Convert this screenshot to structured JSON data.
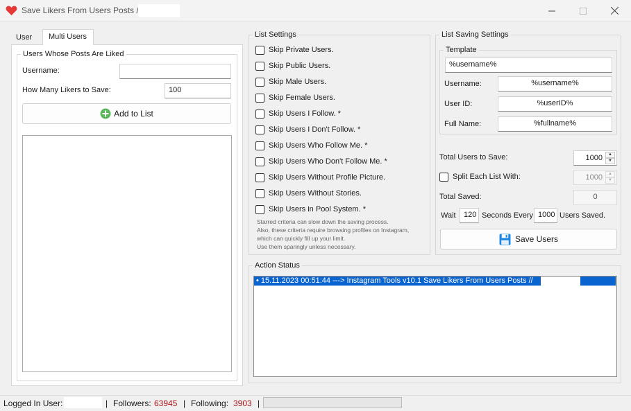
{
  "window": {
    "title": "Save Likers From Users Posts // ",
    "buttons": {
      "minimize": "—",
      "maximize": "☐",
      "close": "✕"
    }
  },
  "tabs": [
    {
      "label": "User",
      "active": false
    },
    {
      "label": "Multi Users",
      "active": true
    }
  ],
  "left_group": {
    "legend": "Users Whose Posts Are Liked",
    "username_label": "Username:",
    "username_value": "",
    "likers_label": "How Many Likers to Save:",
    "likers_value": "100",
    "add_button": "Add to List"
  },
  "list_settings": {
    "legend": "List Settings",
    "options": [
      {
        "label": "Skip Private Users.",
        "checked": false
      },
      {
        "label": "Skip Public Users.",
        "checked": false
      },
      {
        "label": "Skip Male Users.",
        "checked": false
      },
      {
        "label": "Skip Female Users.",
        "checked": false
      },
      {
        "label": "Skip Users I Follow. *",
        "checked": false
      },
      {
        "label": "Skip Users I Don't Follow. *",
        "checked": false
      },
      {
        "label": "Skip Users Who Follow Me. *",
        "checked": false
      },
      {
        "label": "Skip Users Who Don't Follow Me. *",
        "checked": false
      },
      {
        "label": "Skip Users Without Profile Picture.",
        "checked": false
      },
      {
        "label": "Skip Users Without Stories.",
        "checked": false
      },
      {
        "label": "Skip Users in Pool System. *",
        "checked": false
      }
    ],
    "notes": [
      "Starred criteria can slow down the saving process.",
      "Also, these criteria require browsing profiles on Instagram,",
      "which can quickly fill up your limit.",
      "Use them sparingly unless necessary."
    ]
  },
  "saving_settings": {
    "legend": "List Saving Settings",
    "template_legend": "Template",
    "template_value": "%username%",
    "username_label": "Username:",
    "username_value": "%username%",
    "userid_label": "User ID:",
    "userid_value": "%userID%",
    "fullname_label": "Full Name:",
    "fullname_value": "%fullname%",
    "total_label": "Total Users to Save:",
    "total_value": "1000",
    "split_label": "Split Each List With:",
    "split_checked": false,
    "split_value": "1000",
    "saved_label": "Total Saved:",
    "saved_value": "0",
    "wait_label": "Wait",
    "wait_value": "120",
    "seconds_label": "Seconds Every",
    "every_value": "1000",
    "users_saved_label": "Users Saved.",
    "save_button": "Save Users"
  },
  "action_status": {
    "legend": "Action Status",
    "lines": [
      "•  15.11.2023 00:51:44 ---> Instagram Tools v10.1 Save Likers From Users Posts // "
    ]
  },
  "statusbar": {
    "logged_label": "Logged In User:",
    "logged_value": "",
    "sep": "|",
    "followers_label": "Followers:",
    "followers_value": "63945",
    "following_label": "Following:",
    "following_value": "3903",
    "progress": 0
  },
  "colors": {
    "accent": "#0a64d0",
    "count_red": "#a4161a",
    "heart": "#e53935",
    "add_green": "#5cb85c",
    "save_blue": "#1e88e5"
  },
  "icons": {
    "app": "heart-icon",
    "add": "plus-circle-icon",
    "save": "floppy-disk-icon"
  }
}
